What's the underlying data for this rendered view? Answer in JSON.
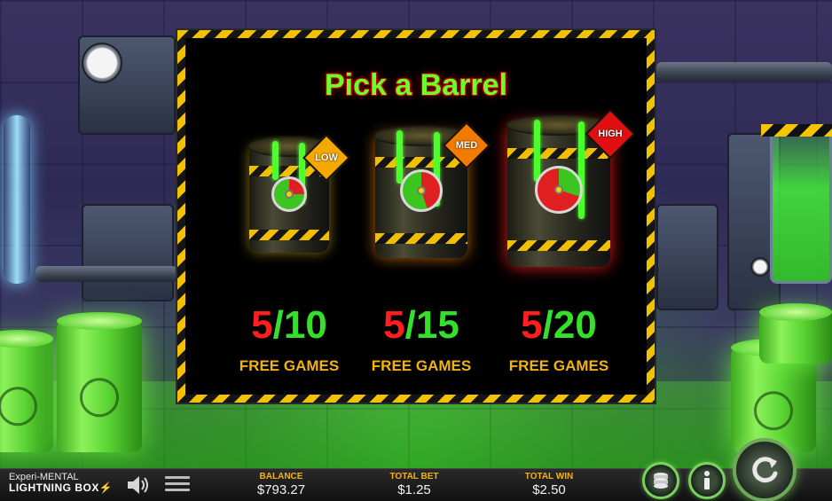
{
  "dialog": {
    "title": "Pick a Barrel",
    "options": [
      {
        "risk": "LOW",
        "spins_a": "5",
        "spins_b": "10",
        "label": "FREE GAMES",
        "tag_color": "#f5a800"
      },
      {
        "risk": "MED",
        "spins_a": "5",
        "spins_b": "15",
        "label": "FREE GAMES",
        "tag_color": "#f27a00"
      },
      {
        "risk": "HIGH",
        "spins_a": "5",
        "spins_b": "20",
        "label": "FREE GAMES",
        "tag_color": "#e01010"
      }
    ],
    "separator": "/"
  },
  "branding": {
    "line1": "Experi-MENTAL",
    "line2": "LIGHTNING BOX",
    "line2_icon": "lightning-bolt-icon"
  },
  "bottombar": {
    "balance_label": "BALANCE",
    "balance": "$793.27",
    "totalbet_label": "TOTAL BET",
    "totalbet": "$1.25",
    "totalwin_label": "TOTAL WIN",
    "totalwin": "$2.50",
    "icons": [
      "speaker-icon",
      "menu-icon",
      "coin-stack-icon",
      "info-icon",
      "spin-icon"
    ]
  },
  "colors": {
    "accent_green": "#6aff2a",
    "accent_red": "#ff1e1e",
    "label_gold": "#f2b310",
    "hazard_yellow": "#f2c200"
  }
}
